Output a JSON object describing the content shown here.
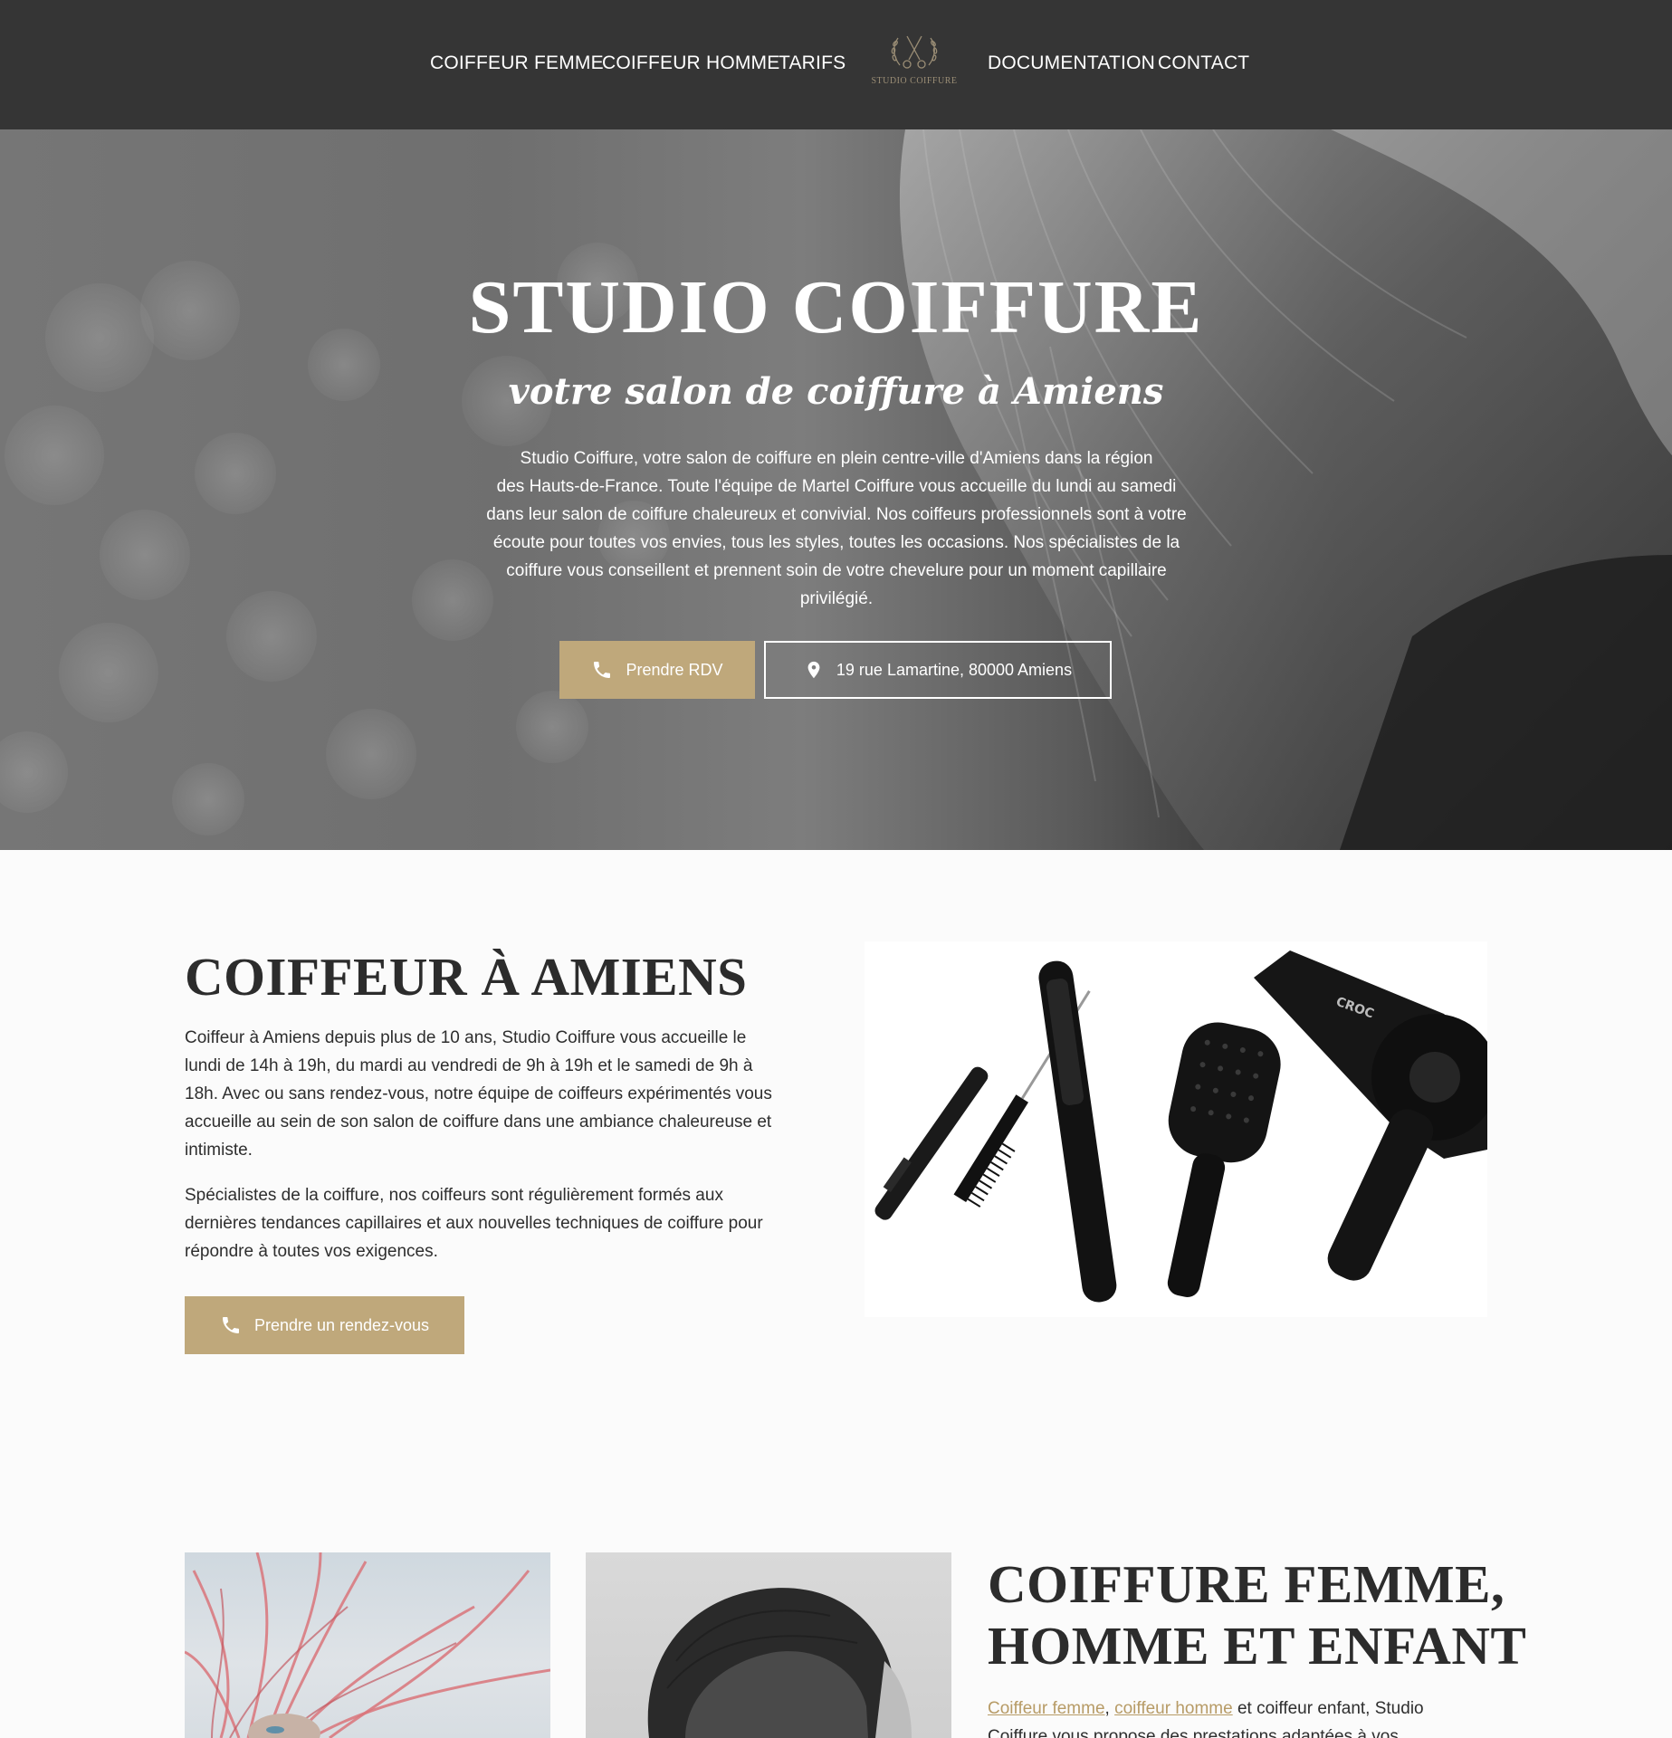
{
  "nav": {
    "items_left": [
      "COIFFEUR FEMME",
      "COIFFEUR HOMME",
      "TARIFS"
    ],
    "items_right": [
      "DOCUMENTATION",
      "CONTACT"
    ],
    "logo_text": "STUDIO COIFFURE"
  },
  "hero": {
    "title": "STUDIO COIFFURE",
    "subtitle": "votre salon de coiffure à Amiens",
    "text_lines": [
      "Studio Coiffure, votre salon de coiffure en plein centre-ville d'Amiens dans la région",
      "des Hauts-de-France. Toute l'équipe de Martel Coiffure vous accueille du lundi au samedi",
      "dans leur salon de coiffure chaleureux et convivial. Nos coiffeurs professionnels sont à votre",
      "écoute pour toutes vos envies, tous les styles, toutes les occasions. Nos spécialistes de la",
      "coiffure vous conseillent et prennent soin de votre chevelure pour un moment capillaire",
      "privilégié."
    ],
    "cta_label": "Prendre RDV",
    "address_label": "19 rue Lamartine, 80000 Amiens"
  },
  "intro": {
    "title": "COIFFEUR À AMIENS",
    "para1_lines": [
      "Coiffeur à Amiens depuis plus de 10 ans, Studio Coiffure vous accueille le",
      "lundi de 14h à 19h, du mardi au vendredi de 9h à 19h et le samedi de 9h à",
      "18h. Avec ou sans rendez-vous, notre équipe de coiffeurs expérimentés vous",
      "accueille au sein de son salon de coiffure dans une ambiance chaleureuse et",
      "intimiste."
    ],
    "para2_lines": [
      "Spécialistes de la coiffure, nos coiffeurs sont régulièrement formés aux",
      "dernières tendances capillaires et aux nouvelles techniques de coiffure pour",
      "répondre à toutes vos exigences."
    ],
    "cta_label": "Prendre un rendez-vous",
    "tool_brand": "CROC"
  },
  "services": {
    "title_line1": "COIFFURE FEMME,",
    "title_line2": "HOMME ET ENFANT",
    "link1": "Coiffeur femme",
    "sep": ",",
    "link2": "coiffeur homme",
    "text_after": "et coiffeur enfant, Studio",
    "line2": "Coiffure vous propose des prestations adaptées à vos"
  },
  "colors": {
    "nav_bg": "#353535",
    "accent_gold": "#bfa87b",
    "link_gold": "#b79b66"
  },
  "icons": [
    "phone-icon",
    "map-pin-icon",
    "scissors-laurel-logo-icon"
  ]
}
